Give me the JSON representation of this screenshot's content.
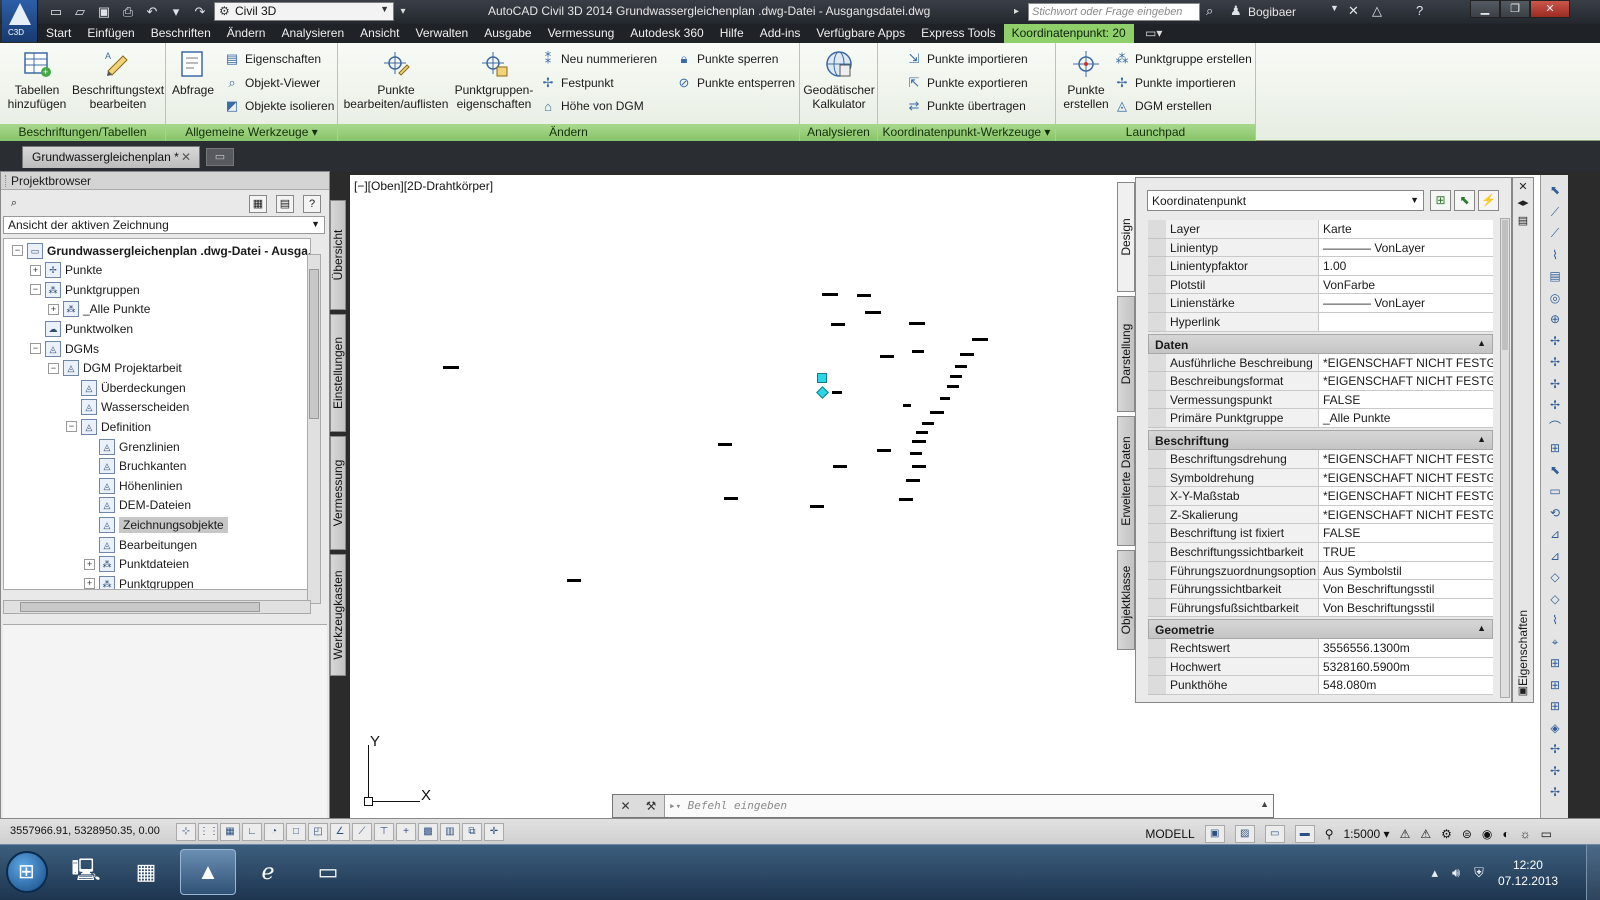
{
  "titlebar": {
    "app_logo_label": "C3D",
    "workspace": "Civil 3D",
    "window_title": "AutoCAD Civil 3D 2014    Grundwassergleichenplan .dwg-Datei - Ausgangsdatei.dwg",
    "search_placeholder": "Stichwort oder Frage eingeben",
    "user": "Bogibaer"
  },
  "menu": {
    "tabs": [
      "Start",
      "Einfügen",
      "Beschriften",
      "Ändern",
      "Analysieren",
      "Ansicht",
      "Verwalten",
      "Ausgabe",
      "Vermessung",
      "Autodesk 360",
      "Hilfe",
      "Add-ins",
      "Verfügbare Apps",
      "Express Tools",
      "Koordinatenpunkt: 20"
    ],
    "active_tab": "Koordinatenpunkt: 20"
  },
  "ribbon": {
    "groups": {
      "beschriftungen": {
        "title": "Beschriftungen/Tabellen",
        "buttons": [
          "Tabellen\nhinzufügen",
          "Beschriftungstext\nbearbeiten"
        ]
      },
      "allgemein": {
        "title": "Allgemeine Werkzeuge",
        "big": "Abfrage",
        "small": [
          "Eigenschaften",
          "Objekt-Viewer",
          "Objekte isolieren"
        ]
      },
      "aendern": {
        "title": "Ändern",
        "big": [
          "Punkte\nbearbeiten/auflisten",
          "Punktgruppen-\neigenschaften"
        ],
        "small_a": [
          "Neu nummerieren",
          "Festpunkt",
          "Höhe von DGM"
        ],
        "small_b": [
          "Punkte sperren",
          "Punkte entsperren"
        ]
      },
      "analysieren": {
        "title": "Analysieren",
        "big": "Geodätischer\nKalkulator"
      },
      "kpwerkzeuge": {
        "title": "Koordinatenpunkt-Werkzeuge",
        "small": [
          "Punkte importieren",
          "Punkte exportieren",
          "Punkte übertragen"
        ]
      },
      "launchpad": {
        "title": "Launchpad",
        "big": "Punkte\nerstellen",
        "small": [
          "Punktgruppe erstellen",
          "Punkte importieren",
          "DGM erstellen"
        ]
      }
    }
  },
  "document_tab": {
    "label": "Grundwassergleichenplan *"
  },
  "projektbrowser": {
    "title": "Projektbrowser",
    "view_select": "Ansicht der aktiven Zeichnung",
    "tree": [
      {
        "label": "Grundwassergleichenplan .dwg-Datei - Ausga...",
        "level": 0,
        "expander": "−",
        "bold": true
      },
      {
        "label": "Punkte",
        "level": 1,
        "expander": "+"
      },
      {
        "label": "Punktgruppen",
        "level": 1,
        "expander": "−"
      },
      {
        "label": "_Alle Punkte",
        "level": 2,
        "expander": "+"
      },
      {
        "label": "Punktwolken",
        "level": 1,
        "expander": ""
      },
      {
        "label": "DGMs",
        "level": 1,
        "expander": "−"
      },
      {
        "label": "DGM Projektarbeit",
        "level": 2,
        "expander": "−"
      },
      {
        "label": "Überdeckungen",
        "level": 3,
        "expander": ""
      },
      {
        "label": "Wasserscheiden",
        "level": 3,
        "expander": ""
      },
      {
        "label": "Definition",
        "level": 3,
        "expander": "−"
      },
      {
        "label": "Grenzlinien",
        "level": 4,
        "expander": ""
      },
      {
        "label": "Bruchkanten",
        "level": 4,
        "expander": ""
      },
      {
        "label": "Höhenlinien",
        "level": 4,
        "expander": ""
      },
      {
        "label": "DEM-Dateien",
        "level": 4,
        "expander": ""
      },
      {
        "label": "Zeichnungsobjekte",
        "level": 4,
        "expander": "",
        "selected": true
      },
      {
        "label": "Bearbeitungen",
        "level": 4,
        "expander": ""
      },
      {
        "label": "Punktdateien",
        "level": 4,
        "expander": "+"
      },
      {
        "label": "Punktgruppen",
        "level": 4,
        "expander": "+"
      }
    ],
    "side_tabs": [
      "Übersicht",
      "Einstellungen",
      "Vermessung",
      "Werkzeugkasten"
    ]
  },
  "viewport": {
    "label": "[−][Oben][2D-Drahtkörper]",
    "ucs_x": "X",
    "ucs_y": "Y"
  },
  "command_line": {
    "placeholder": "Befehl eingeben"
  },
  "properties": {
    "object_type": "Koordinatenpunkt",
    "side_tabs": [
      "Design",
      "Darstellung",
      "Erweiterte Daten",
      "Objektklasse"
    ],
    "palette_label": "Eigenschaften",
    "general": [
      {
        "name": "Layer",
        "value": "Karte"
      },
      {
        "name": "Linientyp",
        "value": "———— VonLayer"
      },
      {
        "name": "Linientypfaktor",
        "value": "1.00"
      },
      {
        "name": "Plotstil",
        "value": "VonFarbe"
      },
      {
        "name": "Linienstärke",
        "value": "———— VonLayer"
      },
      {
        "name": "Hyperlink",
        "value": ""
      }
    ],
    "sections": [
      {
        "title": "Daten",
        "rows": [
          {
            "name": "Ausführliche Beschreibung",
            "value": "*EIGENSCHAFT NICHT FESTGE..."
          },
          {
            "name": "Beschreibungsformat",
            "value": "*EIGENSCHAFT NICHT FESTGE..."
          },
          {
            "name": "Vermessungspunkt",
            "value": "FALSE"
          },
          {
            "name": "Primäre Punktgruppe",
            "value": "_Alle Punkte"
          }
        ]
      },
      {
        "title": "Beschriftung",
        "rows": [
          {
            "name": "Beschriftungsdrehung",
            "value": "*EIGENSCHAFT NICHT FESTGE..."
          },
          {
            "name": "Symboldrehung",
            "value": "*EIGENSCHAFT NICHT FESTGE..."
          },
          {
            "name": "X-Y-Maßstab",
            "value": "*EIGENSCHAFT NICHT FESTGE..."
          },
          {
            "name": "Z-Skalierung",
            "value": "*EIGENSCHAFT NICHT FESTGE..."
          },
          {
            "name": "Beschriftung ist fixiert",
            "value": "FALSE"
          },
          {
            "name": "Beschriftungssichtbarkeit",
            "value": "TRUE"
          },
          {
            "name": "Führungszuordnungsoption",
            "value": "Aus Symbolstil"
          },
          {
            "name": "Führungssichtbarkeit",
            "value": "Von Beschriftungsstil"
          },
          {
            "name": "Führungsfußsichtbarkeit",
            "value": "Von Beschriftungsstil"
          }
        ]
      },
      {
        "title": "Geometrie",
        "rows": [
          {
            "name": "Rechtswert",
            "value": "3556556.1300m"
          },
          {
            "name": "Hochwert",
            "value": "5328160.5900m"
          },
          {
            "name": "Punkthöhe",
            "value": "548.080m"
          }
        ]
      }
    ]
  },
  "statusbar": {
    "coordinates": "3557966.91, 5328950.35, 0.00",
    "model": "MODELL",
    "scale": "1:5000"
  },
  "taskbar": {
    "time": "12:20",
    "date": "07.12.2013"
  },
  "colors": {
    "ribbon_active_tab": "#8fd06a",
    "ribbon_group_title": "#87c468",
    "selection_grip": "#2bd6e8",
    "titlebar": "#2d3138"
  }
}
